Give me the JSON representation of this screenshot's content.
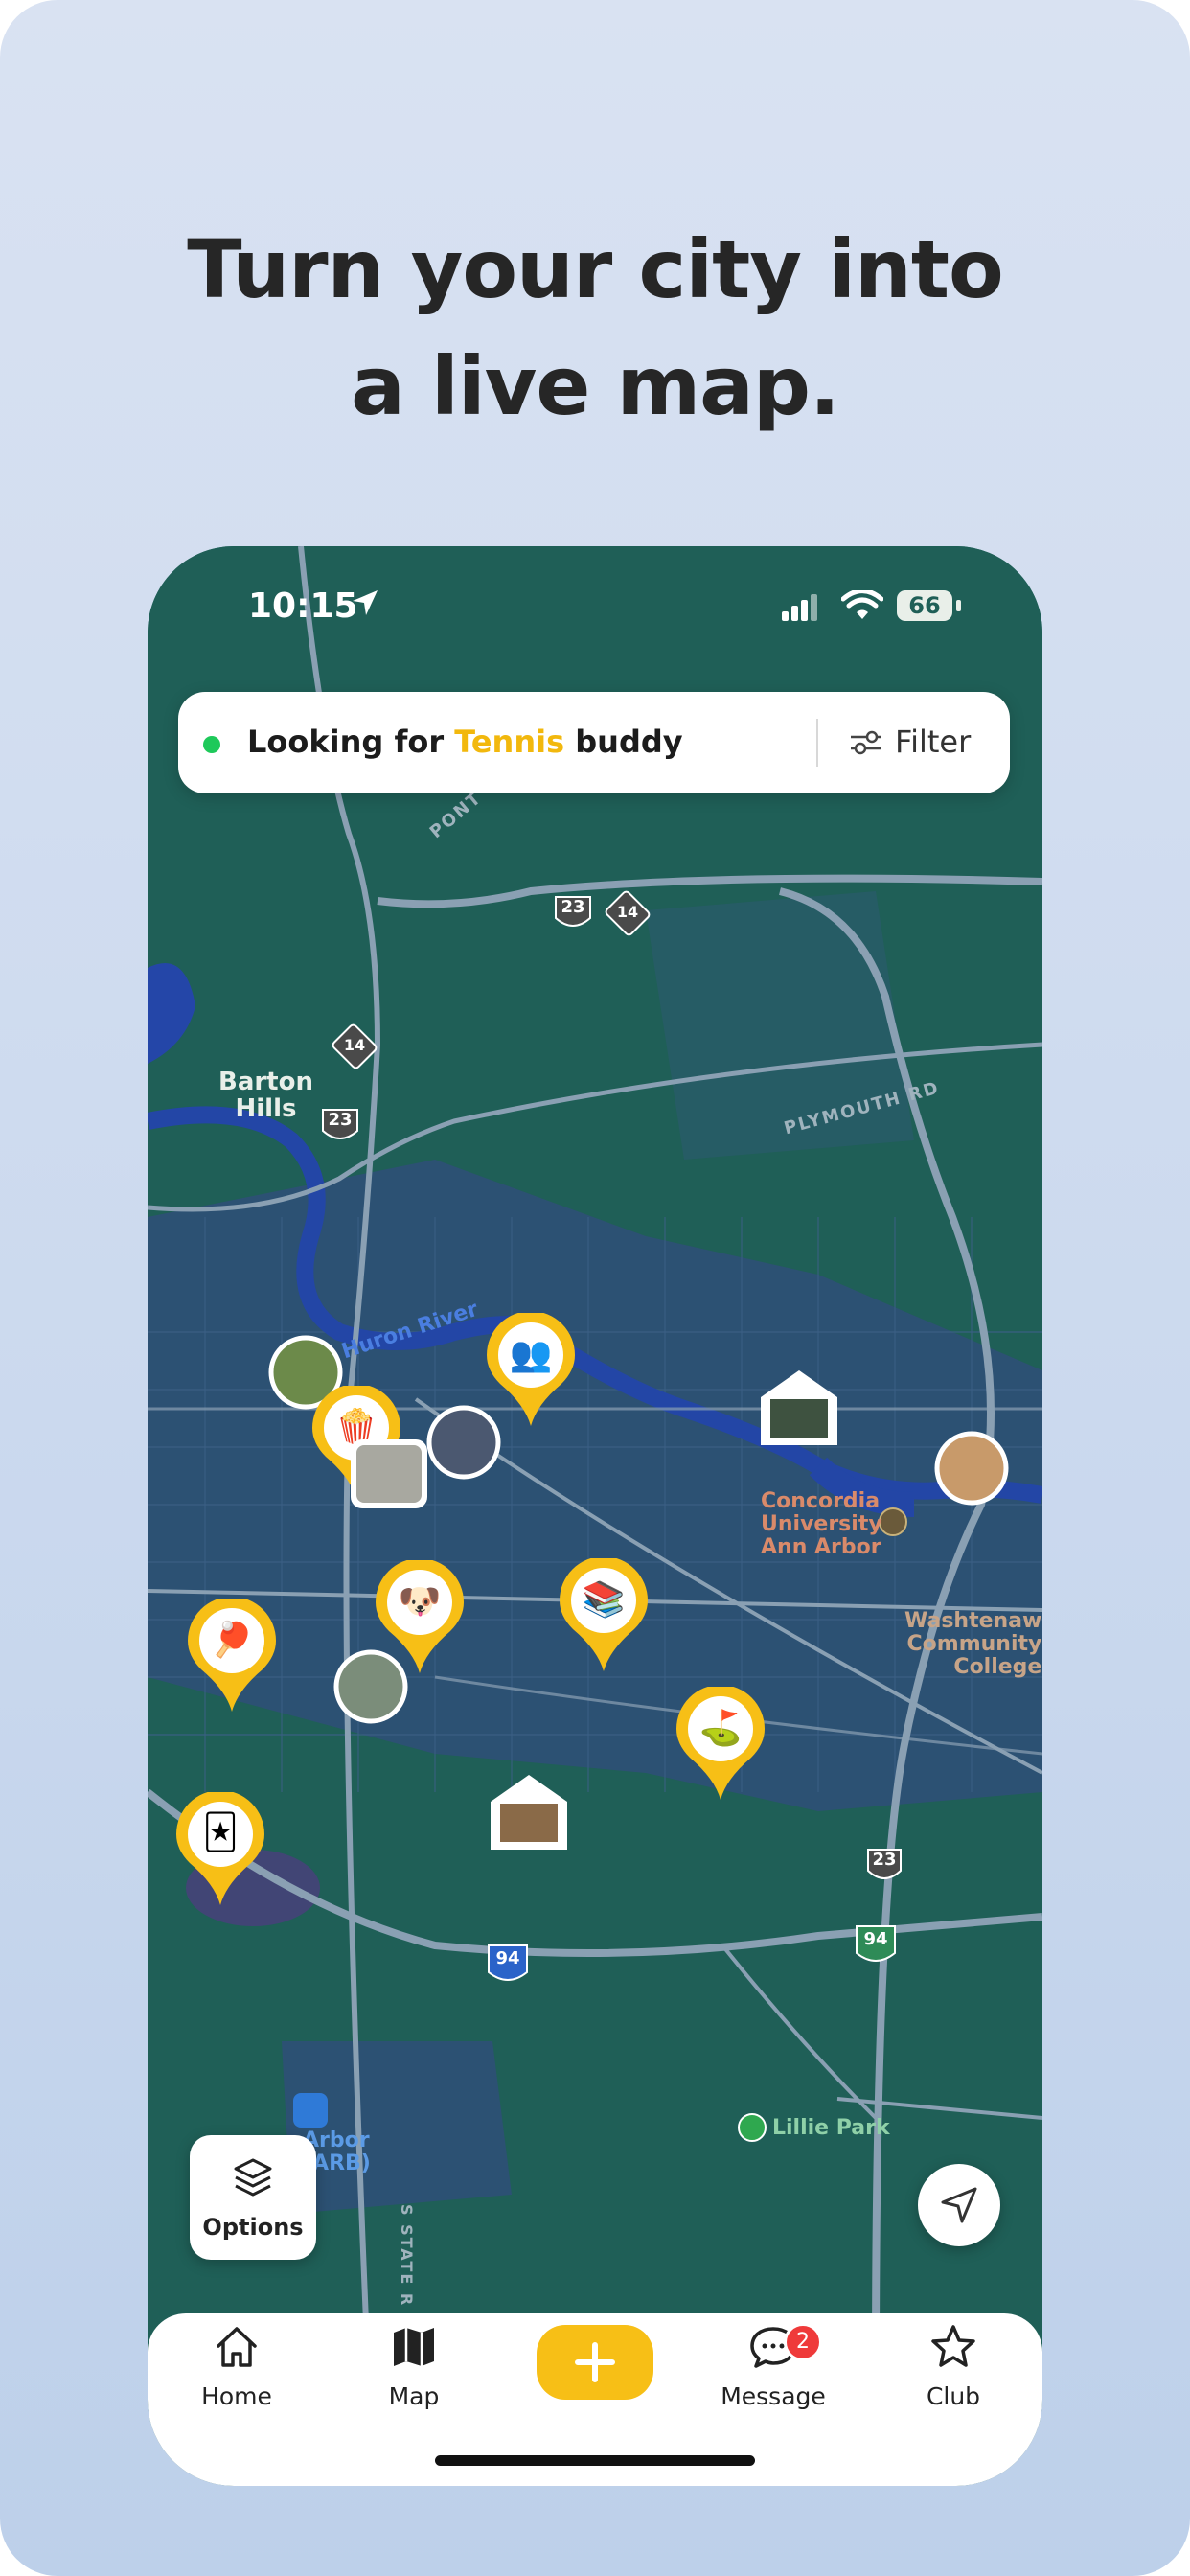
{
  "headline": {
    "line1": "Turn your city into",
    "line2": "a live map."
  },
  "status_bar": {
    "time": "10:15",
    "battery": "66"
  },
  "search": {
    "prefix": "Looking for ",
    "highlight": "Tennis",
    "suffix": " buddy",
    "filter_label": "Filter"
  },
  "map_labels": {
    "barton_hills": "Barton\nHills",
    "huron_river": "Huron River",
    "plymouth_rd": "PLYMOUTH RD",
    "pontiac": "PONT",
    "concordia": "Concordia\nUniversity\nAnn Arbor",
    "washtenaw": "Washtenaw\nCommunity\nCollege",
    "lillie_park": "Lillie Park",
    "airport": "Arbor\n(ARB)",
    "state_rd": "S STATE R",
    "shield_23": "23",
    "shield_14": "14",
    "shield_94": "94"
  },
  "pins": [
    {
      "name": "pin-meeting",
      "emoji": "👥"
    },
    {
      "name": "pin-movies",
      "emoji": "🍿"
    },
    {
      "name": "pin-pets",
      "emoji": "🐶"
    },
    {
      "name": "pin-books",
      "emoji": "📚"
    },
    {
      "name": "pin-pickleball",
      "emoji": "🏓"
    },
    {
      "name": "pin-golf",
      "emoji": "⛳"
    },
    {
      "name": "pin-cards",
      "emoji": "🃏"
    }
  ],
  "options_label": "Options",
  "tabs": [
    {
      "label": "Home",
      "icon": "home-icon"
    },
    {
      "label": "Map",
      "icon": "map-icon"
    },
    {
      "label": "",
      "icon": "plus-icon"
    },
    {
      "label": "Message",
      "icon": "message-icon"
    },
    {
      "label": "Club",
      "icon": "star-icon"
    }
  ],
  "message_badge": "2",
  "colors": {
    "accent": "#F7BF16",
    "map_green": "#1F5F57",
    "map_blue": "#2F4F78",
    "online_dot": "#1EC95A",
    "badge_red": "#EF3A3A"
  }
}
